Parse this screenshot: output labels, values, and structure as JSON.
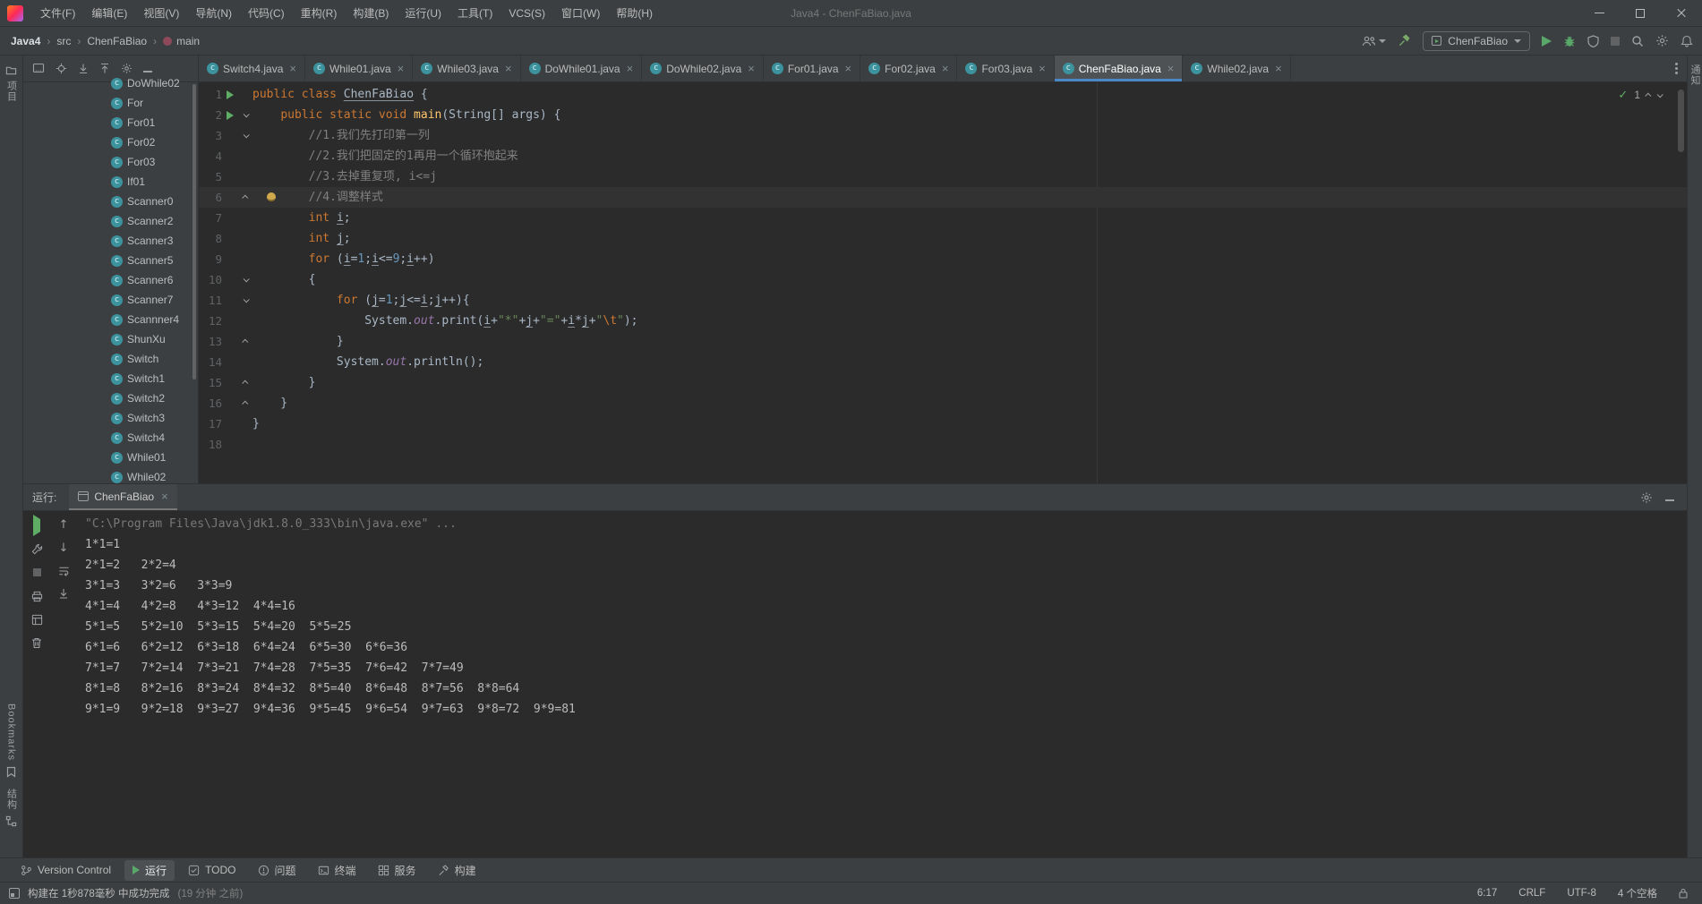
{
  "colors": {
    "panel_bg": "#3c3f41",
    "editor_bg": "#2b2b2b",
    "accent": "#4a88c7",
    "run_green": "#59a869",
    "keyword": "#cc7832",
    "string": "#6a8759",
    "comment": "#808080",
    "number": "#6897bb",
    "method": "#ffc66b",
    "field": "#9876aa",
    "line_number": "#606366"
  },
  "icons": {
    "nav": [
      "users-icon",
      "build-hammer-icon",
      "run-icon",
      "debug-bug-icon",
      "coverage-shield-icon",
      "stop-icon",
      "search-icon",
      "gear-icon",
      "bell-icon"
    ],
    "project_toolbar": [
      "options-icon",
      "locate-file-icon",
      "expand-all-icon",
      "collapse-all-icon",
      "gear-icon",
      "hide-icon"
    ],
    "console_toolbar": [
      "rerun-icon",
      "wrench-icon",
      "stop-icon",
      "print-icon",
      "restore-layout-icon",
      "clear-all-icon",
      "up-arrow-icon",
      "down-arrow-icon",
      "soft-wrap-icon",
      "scroll-to-end-icon"
    ]
  },
  "window": {
    "title": "Java4 - ChenFaBiao.java",
    "menu": [
      "文件(F)",
      "编辑(E)",
      "视图(V)",
      "导航(N)",
      "代码(C)",
      "重构(R)",
      "构建(B)",
      "运行(U)",
      "工具(T)",
      "VCS(S)",
      "窗口(W)",
      "帮助(H)"
    ]
  },
  "navbar": {
    "breadcrumbs": [
      "Java4",
      "src",
      "ChenFaBiao",
      "main"
    ],
    "run_config": "ChenFaBiao"
  },
  "strips": {
    "project": "项目",
    "bookmarks": "Bookmarks",
    "structure": "结构",
    "notifications": "通知"
  },
  "project_panel": {
    "tree": [
      "DoWhile02",
      "For",
      "For01",
      "For02",
      "For03",
      "If01",
      "Scanner0",
      "Scanner2",
      "Scanner3",
      "Scanner5",
      "Scanner6",
      "Scanner7",
      "Scannner4",
      "ShunXu",
      "Switch",
      "Switch1",
      "Switch2",
      "Switch3",
      "Switch4",
      "While01",
      "While02"
    ]
  },
  "editor": {
    "tabs": [
      "Switch4.java",
      "While01.java",
      "While03.java",
      "DoWhile01.java",
      "DoWhile02.java",
      "For01.java",
      "For02.java",
      "For03.java",
      "ChenFaBiao.java",
      "While02.java"
    ],
    "active_tab": "ChenFaBiao.java",
    "inspections": "1",
    "lines": [
      {
        "n": 1,
        "g": "run",
        "t": [
          [
            "k",
            "public"
          ],
          [
            "p",
            " "
          ],
          [
            "k",
            "class"
          ],
          [
            "p",
            " "
          ],
          [
            "ul",
            "ChenFaBiao"
          ],
          [
            "p",
            " {"
          ]
        ]
      },
      {
        "n": 2,
        "g": "run,fold",
        "t": [
          [
            "p",
            "    "
          ],
          [
            "k",
            "public"
          ],
          [
            "p",
            " "
          ],
          [
            "k",
            "static"
          ],
          [
            "p",
            " "
          ],
          [
            "k",
            "void"
          ],
          [
            "p",
            " "
          ],
          [
            "m",
            "main"
          ],
          [
            "p",
            "(String[] args) {"
          ]
        ]
      },
      {
        "n": 3,
        "g": "fold",
        "t": [
          [
            "p",
            "        "
          ],
          [
            "c",
            "//1.我们先打印第一列"
          ]
        ]
      },
      {
        "n": 4,
        "g": "",
        "t": [
          [
            "p",
            "        "
          ],
          [
            "c",
            "//2.我们把固定的1再用一个循环抱起来"
          ]
        ]
      },
      {
        "n": 5,
        "g": "",
        "t": [
          [
            "p",
            "        "
          ],
          [
            "c",
            "//3.去掉重复项, i<=j"
          ]
        ]
      },
      {
        "n": 6,
        "g": "foldend,bulb",
        "caret": true,
        "t": [
          [
            "p",
            "        "
          ],
          [
            "c",
            "//4.调整样式"
          ]
        ]
      },
      {
        "n": 7,
        "g": "",
        "t": [
          [
            "p",
            "        "
          ],
          [
            "k",
            "int"
          ],
          [
            "p",
            " "
          ],
          [
            "ul",
            "i"
          ],
          [
            "p",
            ";"
          ]
        ]
      },
      {
        "n": 8,
        "g": "",
        "t": [
          [
            "p",
            "        "
          ],
          [
            "k",
            "int"
          ],
          [
            "p",
            " "
          ],
          [
            "ul",
            "j"
          ],
          [
            "p",
            ";"
          ]
        ]
      },
      {
        "n": 9,
        "g": "",
        "t": [
          [
            "p",
            "        "
          ],
          [
            "k",
            "for"
          ],
          [
            "p",
            " ("
          ],
          [
            "ul",
            "i"
          ],
          [
            "p",
            "="
          ],
          [
            "n",
            "1"
          ],
          [
            "p",
            ";"
          ],
          [
            "ul",
            "i"
          ],
          [
            "p",
            "<="
          ],
          [
            "n",
            "9"
          ],
          [
            "p",
            ";"
          ],
          [
            "ul",
            "i"
          ],
          [
            "p",
            "++)"
          ]
        ]
      },
      {
        "n": 10,
        "g": "fold",
        "t": [
          [
            "p",
            "        {"
          ]
        ]
      },
      {
        "n": 11,
        "g": "fold",
        "t": [
          [
            "p",
            "            "
          ],
          [
            "k",
            "for"
          ],
          [
            "p",
            " ("
          ],
          [
            "ul",
            "j"
          ],
          [
            "p",
            "="
          ],
          [
            "n",
            "1"
          ],
          [
            "p",
            ";"
          ],
          [
            "ul",
            "j"
          ],
          [
            "p",
            "<="
          ],
          [
            "ul",
            "i"
          ],
          [
            "p",
            ";"
          ],
          [
            "ul",
            "j"
          ],
          [
            "p",
            "++){"
          ]
        ]
      },
      {
        "n": 12,
        "g": "",
        "t": [
          [
            "p",
            "                System."
          ],
          [
            "f",
            "out"
          ],
          [
            "p",
            ".print("
          ],
          [
            "ul",
            "i"
          ],
          [
            "p",
            "+"
          ],
          [
            "s",
            "\"*\""
          ],
          [
            "p",
            "+"
          ],
          [
            "ul",
            "j"
          ],
          [
            "p",
            "+"
          ],
          [
            "s",
            "\"=\""
          ],
          [
            "p",
            "+"
          ],
          [
            "ul",
            "i"
          ],
          [
            "p",
            "*"
          ],
          [
            "ul",
            "j"
          ],
          [
            "p",
            "+"
          ],
          [
            "s",
            "\""
          ],
          [
            "e",
            "\\t"
          ],
          [
            "s",
            "\""
          ],
          [
            "p",
            ");"
          ]
        ]
      },
      {
        "n": 13,
        "g": "foldend",
        "t": [
          [
            "p",
            "            }"
          ]
        ]
      },
      {
        "n": 14,
        "g": "",
        "t": [
          [
            "p",
            "            System."
          ],
          [
            "f",
            "out"
          ],
          [
            "p",
            ".println();"
          ]
        ]
      },
      {
        "n": 15,
        "g": "foldend",
        "t": [
          [
            "p",
            "        }"
          ]
        ]
      },
      {
        "n": 16,
        "g": "foldend",
        "t": [
          [
            "p",
            "    }"
          ]
        ]
      },
      {
        "n": 17,
        "g": "",
        "t": [
          [
            "p",
            "}"
          ]
        ]
      },
      {
        "n": 18,
        "g": "",
        "t": []
      }
    ]
  },
  "run_panel": {
    "label": "运行:",
    "tab": "ChenFaBiao",
    "command_line": "\"C:\\Program Files\\Java\\jdk1.8.0_333\\bin\\java.exe\" ...",
    "output": [
      "1*1=1",
      "2*1=2\t2*2=4",
      "3*1=3\t3*2=6\t3*3=9",
      "4*1=4\t4*2=8\t4*3=12\t4*4=16",
      "5*1=5\t5*2=10\t5*3=15\t5*4=20\t5*5=25",
      "6*1=6\t6*2=12\t6*3=18\t6*4=24\t6*5=30\t6*6=36",
      "7*1=7\t7*2=14\t7*3=21\t7*4=28\t7*5=35\t7*6=42\t7*7=49",
      "8*1=8\t8*2=16\t8*3=24\t8*4=32\t8*5=40\t8*6=48\t8*7=56\t8*8=64",
      "9*1=9\t9*2=18\t9*3=27\t9*4=36\t9*5=45\t9*6=54\t9*7=63\t9*8=72\t9*9=81"
    ]
  },
  "bottom_bar": {
    "items": [
      "Version Control",
      "运行",
      "TODO",
      "问题",
      "终端",
      "服务",
      "构建"
    ],
    "active_item": "运行"
  },
  "status_bar": {
    "message": "构建在 1秒878毫秒 中成功完成",
    "message_time": "(19 分钟 之前)",
    "position": "6:17",
    "line_ending": "CRLF",
    "encoding": "UTF-8",
    "indent": "4 个空格"
  }
}
